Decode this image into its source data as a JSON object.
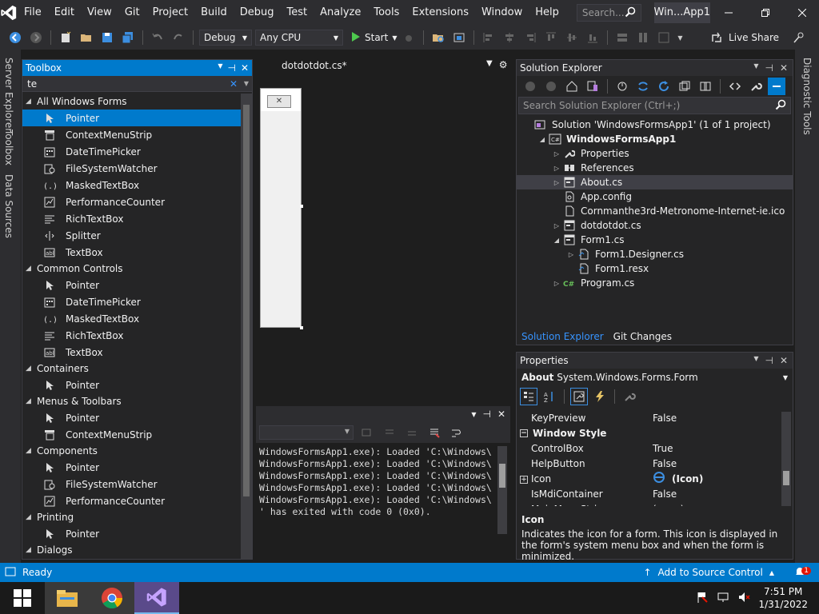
{
  "menu": {
    "items": [
      "File",
      "Edit",
      "View",
      "Git",
      "Project",
      "Build",
      "Debug",
      "Test",
      "Analyze",
      "Tools",
      "Extensions",
      "Window",
      "Help"
    ],
    "search_placeholder": "Search...",
    "window_title": "Win...App1"
  },
  "toolbar": {
    "config": "Debug",
    "platform": "Any CPU",
    "start_label": "Start",
    "live_share": "Live Share"
  },
  "left_strip": {
    "tabs": [
      "Server Explorer",
      "Toolbox",
      "Data Sources"
    ]
  },
  "right_strip": {
    "tabs": [
      "Diagnostic Tools"
    ]
  },
  "toolbox": {
    "title": "Toolbox",
    "search_value": "te",
    "groups": [
      {
        "name": "All Windows Forms",
        "items": [
          "Pointer",
          "ContextMenuStrip",
          "DateTimePicker",
          "FileSystemWatcher",
          "MaskedTextBox",
          "PerformanceCounter",
          "RichTextBox",
          "Splitter",
          "TextBox"
        ]
      },
      {
        "name": "Common Controls",
        "items": [
          "Pointer",
          "DateTimePicker",
          "MaskedTextBox",
          "RichTextBox",
          "TextBox"
        ]
      },
      {
        "name": "Containers",
        "items": [
          "Pointer"
        ]
      },
      {
        "name": "Menus & Toolbars",
        "items": [
          "Pointer",
          "ContextMenuStrip"
        ]
      },
      {
        "name": "Components",
        "items": [
          "Pointer",
          "FileSystemWatcher",
          "PerformanceCounter"
        ]
      },
      {
        "name": "Printing",
        "items": [
          "Pointer"
        ]
      },
      {
        "name": "Dialogs",
        "items": []
      }
    ],
    "selected_item": "Pointer"
  },
  "editor": {
    "tab_title": "dotdotdot.cs*"
  },
  "output": {
    "lines": [
      "WindowsFormsApp1.exe): Loaded 'C:\\Windows\\",
      "WindowsFormsApp1.exe): Loaded 'C:\\Windows\\",
      "WindowsFormsApp1.exe): Loaded 'C:\\Windows\\",
      "WindowsFormsApp1.exe): Loaded 'C:\\Windows\\",
      "WindowsFormsApp1.exe): Loaded 'C:\\Windows\\",
      "' has exited with code 0 (0x0)."
    ]
  },
  "solution_explorer": {
    "title": "Solution Explorer",
    "search_placeholder": "Search Solution Explorer (Ctrl+;)",
    "tree": [
      {
        "label": "Solution 'WindowsFormsApp1' (1 of 1 project)",
        "level": 0,
        "expand": "",
        "icon": "solution-icon"
      },
      {
        "label": "WindowsFormsApp1",
        "level": 1,
        "expand": "open",
        "icon": "csharp-project-icon",
        "bold": true
      },
      {
        "label": "Properties",
        "level": 2,
        "expand": "closed",
        "icon": "wrench-icon"
      },
      {
        "label": "References",
        "level": 2,
        "expand": "closed",
        "icon": "references-icon"
      },
      {
        "label": "About.cs",
        "level": 2,
        "expand": "closed",
        "icon": "form-file-icon",
        "selected": true
      },
      {
        "label": "App.config",
        "level": 2,
        "expand": "",
        "icon": "config-file-icon"
      },
      {
        "label": "Cornmanthe3rd-Metronome-Internet-ie.ico",
        "level": 2,
        "expand": "",
        "icon": "ico-file-icon"
      },
      {
        "label": "dotdotdot.cs",
        "level": 2,
        "expand": "closed",
        "icon": "form-file-icon"
      },
      {
        "label": "Form1.cs",
        "level": 2,
        "expand": "open",
        "icon": "form-file-icon"
      },
      {
        "label": "Form1.Designer.cs",
        "level": 3,
        "expand": "closed",
        "icon": "designer-file-icon"
      },
      {
        "label": "Form1.resx",
        "level": 3,
        "expand": "",
        "icon": "resx-file-icon"
      },
      {
        "label": "Program.cs",
        "level": 2,
        "expand": "closed",
        "icon": "csharp-file-icon"
      }
    ],
    "tabs": [
      "Solution Explorer",
      "Git Changes"
    ]
  },
  "properties": {
    "title": "Properties",
    "object_name": "About",
    "object_type": "System.Windows.Forms.Form",
    "rows": [
      {
        "kind": "prop",
        "name": "KeyPreview",
        "value": "False"
      },
      {
        "kind": "cat",
        "name": "Window Style"
      },
      {
        "kind": "prop",
        "name": "ControlBox",
        "value": "True"
      },
      {
        "kind": "prop",
        "name": "HelpButton",
        "value": "False"
      },
      {
        "kind": "prop",
        "name": "Icon",
        "value": "(Icon)",
        "expandable": true,
        "bold_value": true
      },
      {
        "kind": "prop",
        "name": "IsMdiContainer",
        "value": "False"
      },
      {
        "kind": "prop",
        "name": "MainMenuStrip",
        "value": "(none)"
      }
    ],
    "description_title": "Icon",
    "description_text": "Indicates the icon for a form. This icon is displayed in the form's system menu box and when the form is minimized."
  },
  "status": {
    "ready": "Ready",
    "source_control": "Add to Source Control",
    "notification_count": "1"
  },
  "taskbar": {
    "time": "7:51 PM",
    "date": "1/31/2022"
  },
  "colors": {
    "accent": "#007acc",
    "background": "#1e1e1e",
    "panel": "#252526",
    "chrome": "#2d2d30"
  }
}
